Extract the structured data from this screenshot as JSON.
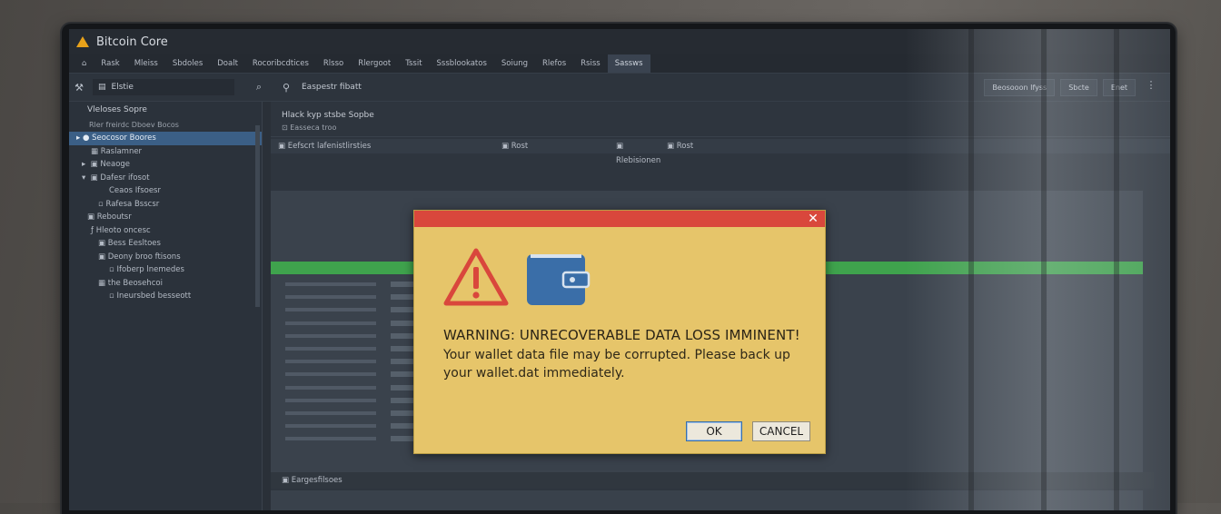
{
  "window": {
    "title": "Bitcoin Core"
  },
  "menu": [
    "Rask",
    "Mleiss",
    "Sbdoles",
    "Doalt",
    "Rocoribcdtices",
    "Rlsso",
    "Rlergoot",
    "Tssit",
    "Sssblookatos",
    "Soiung",
    "Rlefos",
    "Rsiss",
    "Sassws"
  ],
  "toolbar": {
    "search": "Elstie",
    "label": "Easpestr fibatt",
    "buttons": [
      "Beosooon Ifyss",
      "Sbcte",
      "Enet"
    ]
  },
  "sidebar": {
    "title": "Vleloses Sopre",
    "subtitle": "Rler freirdc Dboev Bocos",
    "items": [
      "Seocosor Boores",
      "Raslamner",
      "Neaoge",
      "Dafesr ifosot",
      "Ceaos Ifsoesr",
      "Rafesa Bsscsr",
      "Reboutsr",
      "Hleoto oncesc",
      "Bess Eesltoes",
      "Deony broo ftisons",
      "Ifoberp lnemedes",
      "the Beosehcoi",
      "Ineursbed besseott"
    ]
  },
  "main": {
    "heading": "Hlack kyp stsbe Sopbe",
    "subrow": "Easseca troo",
    "tabs": [
      "Eefscrt lafenistlirsties",
      "Rost",
      "Rlebisionen",
      "Rost"
    ],
    "bottom_tab": "Eargesfilsoes"
  },
  "dialog": {
    "close": "✕",
    "heading": "WARNING: UNRECOVERABLE DATA LOSS IMMINENT!",
    "body": "Your wallet data file may be corrupted. Please back up your wallet.dat immediately.",
    "ok": "OK",
    "cancel": "CANCEL",
    "colors": {
      "header": "#d9473c",
      "body": "#e6c56a",
      "warning": "#d9473c",
      "wallet": "#3a6ea8"
    },
    "icons": [
      "warning-triangle-icon",
      "wallet-icon"
    ]
  }
}
